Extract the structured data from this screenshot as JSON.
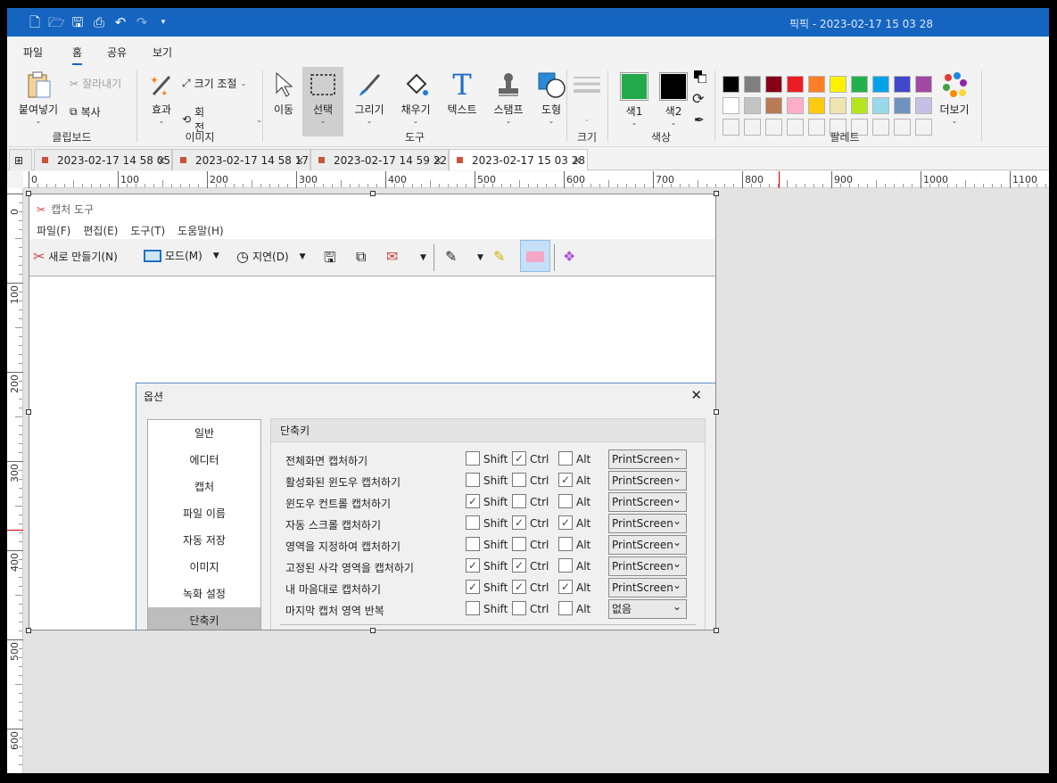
{
  "window": {
    "title": "픽픽 - 2023-02-17 15 03 28"
  },
  "menu_tabs": [
    "파일",
    "홈",
    "공유",
    "보기"
  ],
  "ribbon": {
    "clipboard": {
      "paste": "붙여넣기",
      "cut": "잘라내기",
      "copy": "복사",
      "group": "클립보드"
    },
    "image": {
      "effects": "효과",
      "resize": "크기 조절",
      "rotate": "회전",
      "group": "이미지"
    },
    "tools": {
      "move": "이동",
      "select": "선택",
      "draw": "그리기",
      "fill": "채우기",
      "text": "텍스트",
      "stamp": "스탬프",
      "shape": "도형",
      "group": "도구"
    },
    "size": {
      "group": "크기"
    },
    "color": {
      "color1": "색1",
      "color2": "색2",
      "group": "색상",
      "color1_hex": "#22a94b",
      "color2_hex": "#000000"
    },
    "palette": {
      "more": "더보기",
      "group": "팔레트",
      "row1": [
        "#000000",
        "#7f7f7f",
        "#880015",
        "#ed1c24",
        "#ff7f27",
        "#fff200",
        "#22b14c",
        "#00a2e8",
        "#3f48cc",
        "#a349a4"
      ],
      "row2": [
        "#ffffff",
        "#c3c3c3",
        "#b97a57",
        "#ffaec9",
        "#ffc90e",
        "#efe4b0",
        "#b5e61d",
        "#99d9ea",
        "#7092be",
        "#c8bfe7"
      ]
    }
  },
  "doc_tabs": [
    "2023-02-17 14 58 05",
    "2023-02-17 14 58 17",
    "2023-02-17 14 59 22",
    "2023-02-17 15 03 28"
  ],
  "hruler": [
    "0",
    "100",
    "200",
    "300",
    "400",
    "500",
    "600",
    "700",
    "800",
    "900",
    "1000",
    "1100"
  ],
  "vruler": [
    "0",
    "100",
    "200",
    "300",
    "400",
    "500",
    "600"
  ],
  "snip": {
    "title": "캡처 도구",
    "menu": [
      "파일(F)",
      "편집(E)",
      "도구(T)",
      "도움말(H)"
    ],
    "new": "새로 만들기(N)",
    "mode": "모드(M)",
    "delay": "지연(D)"
  },
  "options": {
    "title": "옵션",
    "nav": [
      "일반",
      "에디터",
      "캡처",
      "파일 이름",
      "자동 저장",
      "이미지",
      "녹화 설정",
      "단축키"
    ],
    "panel_title": "단축키",
    "mods": [
      "Shift",
      "Ctrl",
      "Alt"
    ],
    "rows": [
      {
        "label": "전체화면 캡처하기",
        "shift": false,
        "ctrl": true,
        "alt": false,
        "key": "PrintScreen"
      },
      {
        "label": "활성화된 윈도우 캡처하기",
        "shift": false,
        "ctrl": false,
        "alt": true,
        "key": "PrintScreen"
      },
      {
        "label": "윈도우 컨트롤 캡처하기",
        "shift": true,
        "ctrl": false,
        "alt": false,
        "key": "PrintScreen"
      },
      {
        "label": "자동 스크롤 캡처하기",
        "shift": false,
        "ctrl": true,
        "alt": true,
        "key": "PrintScreen"
      },
      {
        "label": "영역을 지정하여 캡처하기",
        "shift": false,
        "ctrl": false,
        "alt": false,
        "key": "PrintScreen"
      },
      {
        "label": "고정된 사각 영역을 캡처하기",
        "shift": true,
        "ctrl": true,
        "alt": false,
        "key": "PrintScreen"
      },
      {
        "label": "내 마음대로 캡처하기",
        "shift": true,
        "ctrl": true,
        "alt": true,
        "key": "PrintScreen"
      },
      {
        "label": "마지막 캡처 영역 반복",
        "shift": false,
        "ctrl": false,
        "alt": false,
        "key": "없음"
      }
    ]
  }
}
